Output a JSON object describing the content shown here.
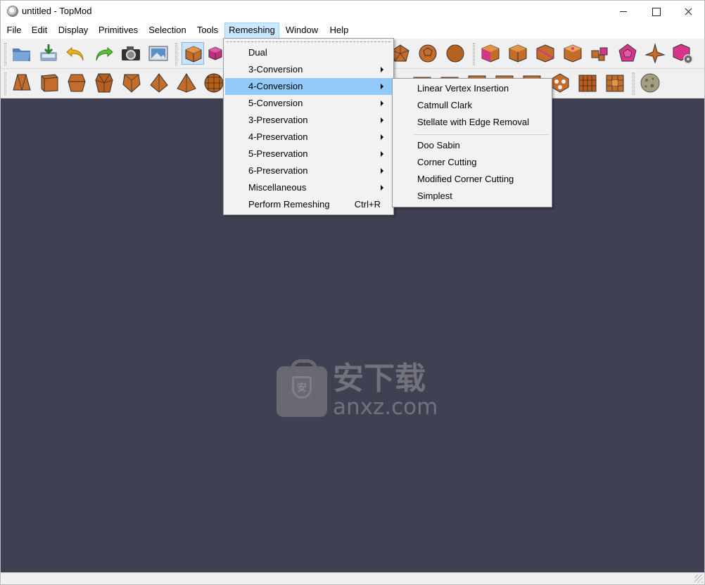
{
  "window": {
    "title": "untitled - TopMod"
  },
  "menubar": [
    {
      "label": "File"
    },
    {
      "label": "Edit"
    },
    {
      "label": "Display"
    },
    {
      "label": "Primitives"
    },
    {
      "label": "Selection"
    },
    {
      "label": "Tools"
    },
    {
      "label": "Remeshing"
    },
    {
      "label": "Window"
    },
    {
      "label": "Help"
    }
  ],
  "remeshing_menu": {
    "items": [
      {
        "label": "Dual"
      },
      {
        "label": "3-Conversion"
      },
      {
        "label": "4-Conversion"
      },
      {
        "label": "5-Conversion"
      },
      {
        "label": "3-Preservation"
      },
      {
        "label": "4-Preservation"
      },
      {
        "label": "5-Preservation"
      },
      {
        "label": "6-Preservation"
      },
      {
        "label": "Miscellaneous"
      },
      {
        "label": "Perform Remeshing",
        "shortcut": "Ctrl+R"
      }
    ]
  },
  "conversion4_submenu": {
    "items": [
      {
        "label": "Linear Vertex Insertion"
      },
      {
        "label": "Catmull Clark"
      },
      {
        "label": "Stellate with Edge Removal"
      },
      {
        "label": "Doo Sabin"
      },
      {
        "label": "Corner Cutting"
      },
      {
        "label": "Modified Corner Cutting"
      },
      {
        "label": "Simplest"
      }
    ]
  },
  "watermark": {
    "cn": "安下载",
    "en": "anxz.com",
    "badge": "安"
  },
  "colors": {
    "viewport": "#3f4153",
    "menu_highlight": "#91c9f7",
    "mesh_orange": "#d9803a",
    "mesh_magenta": "#d6358a"
  },
  "toolbar_icons": [
    "open-file-icon",
    "save-file-icon",
    "undo-icon",
    "redo-icon",
    "screenshot-camera-icon",
    "render-image-icon",
    "cube-icon",
    "magenta-cube-icon"
  ]
}
